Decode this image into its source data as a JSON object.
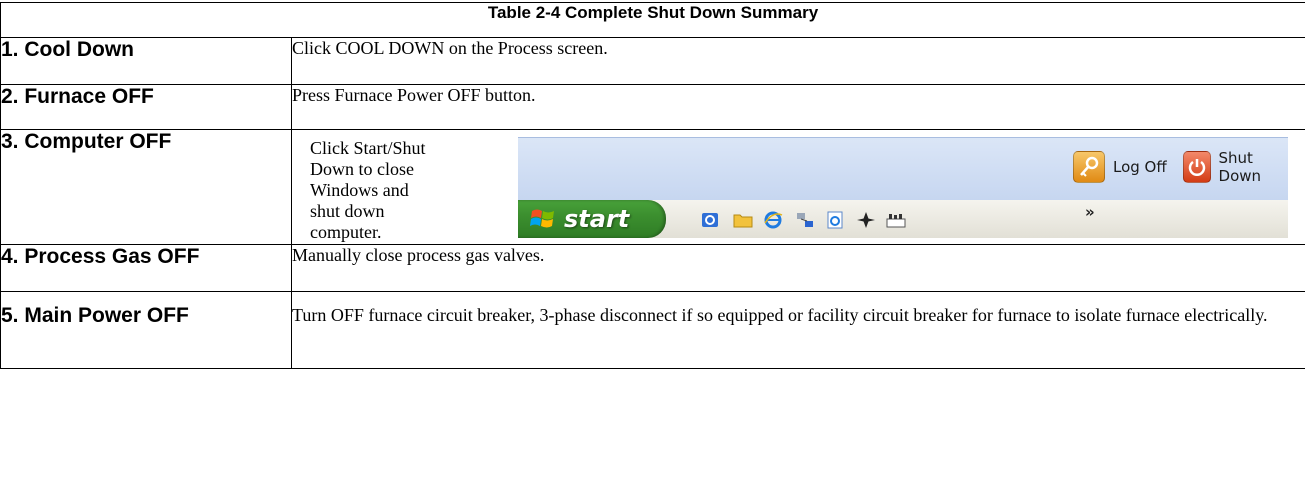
{
  "table": {
    "title": "Table 2-4 Complete Shut Down Summary",
    "rows": [
      {
        "step": "1. Cool Down",
        "action": "Click COOL DOWN on the Process screen."
      },
      {
        "step": "2. Furnace OFF",
        "action": "Press Furnace Power OFF button."
      },
      {
        "step": "3. Computer OFF",
        "action": "Click Start/Shut Down to close Windows and shut down computer."
      },
      {
        "step": "4. Process Gas OFF",
        "action": "Manually close process gas valves."
      },
      {
        "step": "5. Main Power OFF",
        "action": "Turn OFF furnace circuit breaker, 3-phase disconnect if so equipped or facility circuit breaker for furnace to isolate furnace electrically."
      }
    ]
  },
  "screenshot": {
    "log_off_label": "Log Off",
    "shut_down_label": "Shut Down",
    "start_label": "start",
    "overflow_glyph": "»",
    "quick_launch_icons": [
      "outlook-express-icon",
      "folder-icon",
      "internet-explorer-icon",
      "network-icon",
      "ie-page-icon",
      "compass-icon",
      "toolbar-app-icon"
    ]
  },
  "colors": {
    "xp_start_green": "#3c8f2f",
    "xp_menu_bg": "#d3dff4",
    "log_off_orange": "#e08a14",
    "shut_down_red": "#d33b14"
  }
}
